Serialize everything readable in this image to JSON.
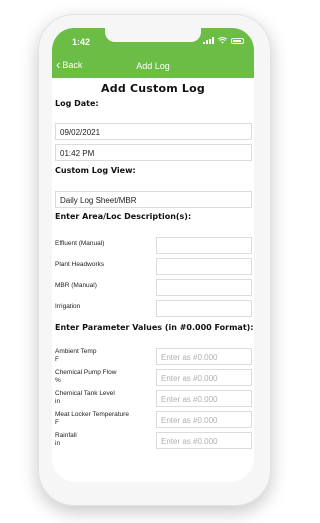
{
  "status": {
    "time": "1:42"
  },
  "nav": {
    "back_label": "Back",
    "title": "Add Log"
  },
  "page": {
    "title": "Add Custom Log"
  },
  "log_date": {
    "heading": "Log Date:",
    "date": "09/02/2021",
    "time": "01:42 PM"
  },
  "log_view": {
    "heading": "Custom Log View:",
    "value": "Daily Log Sheet/MBR"
  },
  "area": {
    "heading": "Enter Area/Loc Description(s):",
    "rows": [
      {
        "label": "Effluent (Manual)"
      },
      {
        "label": "Plant Headworks"
      },
      {
        "label": "MBR (Manual)"
      },
      {
        "label": "Irrigation"
      }
    ]
  },
  "params": {
    "heading": "Enter Parameter Values (in #0.000 Format):",
    "placeholder": "Enter as #0.000",
    "rows": [
      {
        "label": "Ambient Temp",
        "unit": "F"
      },
      {
        "label": "Chemical Pump Flow",
        "unit": "%"
      },
      {
        "label": "Chemical Tank Level",
        "unit": "in"
      },
      {
        "label": "Meat Locker Temperature",
        "unit": "F"
      },
      {
        "label": "Rainfall",
        "unit": "in"
      }
    ]
  },
  "colors": {
    "accent": "#6bbd45"
  }
}
